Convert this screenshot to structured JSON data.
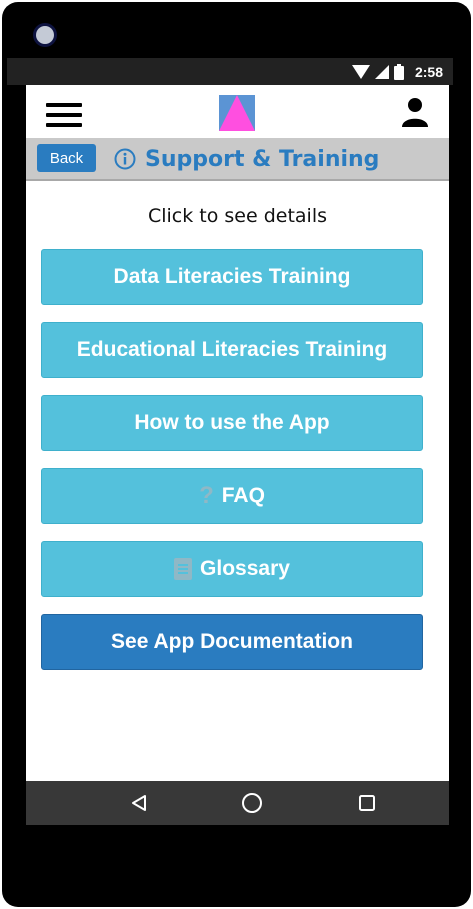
{
  "status_bar": {
    "time": "2:58"
  },
  "header": {
    "back_label": "Back",
    "title": "Support & Training"
  },
  "main": {
    "hint": "Click to see details",
    "buttons": [
      {
        "label": "Data Literacies Training"
      },
      {
        "label": "Educational Literacies Training"
      },
      {
        "label": "How to use the App"
      },
      {
        "label": "FAQ",
        "icon": "question-mark-icon",
        "icon_glyph": "?"
      },
      {
        "label": "Glossary",
        "icon": "document-icon"
      },
      {
        "label": "See App Documentation"
      }
    ]
  },
  "colors": {
    "accent": "#2a7cc0",
    "button": "#54c1dc",
    "logo_pink": "#ff4fe0",
    "logo_blue": "#5b94d4",
    "subbar": "#c9c9c9"
  }
}
